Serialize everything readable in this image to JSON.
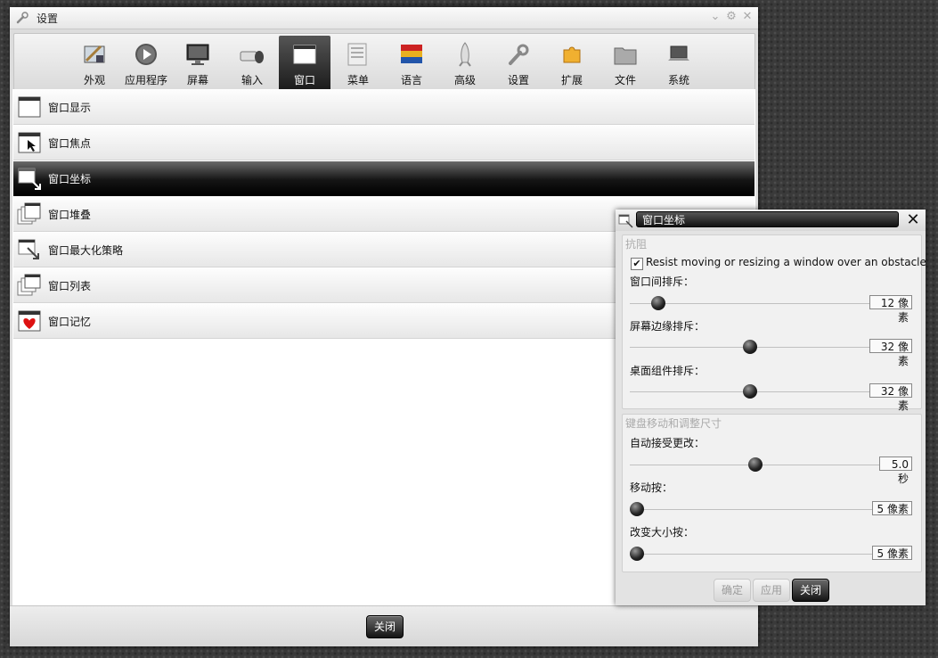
{
  "main_window": {
    "title": "设置",
    "toolbar": [
      {
        "label": "外观",
        "icon": "appearance-icon"
      },
      {
        "label": "应用程序",
        "icon": "applications-icon"
      },
      {
        "label": "屏幕",
        "icon": "screen-icon"
      },
      {
        "label": "输入",
        "icon": "input-icon"
      },
      {
        "label": "窗口",
        "icon": "window-icon",
        "active": true
      },
      {
        "label": "菜单",
        "icon": "menu-icon"
      },
      {
        "label": "语言",
        "icon": "language-icon"
      },
      {
        "label": "高级",
        "icon": "advanced-icon"
      },
      {
        "label": "设置",
        "icon": "settings-icon"
      },
      {
        "label": "扩展",
        "icon": "extensions-icon"
      },
      {
        "label": "文件",
        "icon": "files-icon"
      },
      {
        "label": "系统",
        "icon": "system-icon"
      }
    ],
    "list": [
      {
        "label": "窗口显示",
        "icon": "window-display-icon"
      },
      {
        "label": "窗口焦点",
        "icon": "window-focus-icon"
      },
      {
        "label": "窗口坐标",
        "icon": "window-geometry-icon",
        "selected": true
      },
      {
        "label": "窗口堆叠",
        "icon": "window-stacking-icon"
      },
      {
        "label": "窗口最大化策略",
        "icon": "window-maximize-icon"
      },
      {
        "label": "窗口列表",
        "icon": "window-list-icon"
      },
      {
        "label": "窗口记忆",
        "icon": "window-remember-icon"
      }
    ],
    "close_label": "关闭"
  },
  "dialog": {
    "title": "窗口坐标",
    "resist_group": {
      "title": "抗阻",
      "checkbox_label": "Resist moving or resizing a window over an obstacle",
      "checkbox_checked": true,
      "sliders": [
        {
          "label": "窗口间排斥：",
          "value_text": "12 像素",
          "fraction": 0.12
        },
        {
          "label": "屏幕边缘排斥：",
          "value_text": "32 像素",
          "fraction": 0.5
        },
        {
          "label": "桌面组件排斥：",
          "value_text": "32 像素",
          "fraction": 0.5
        }
      ]
    },
    "keyboard_group": {
      "title": "键盘移动和调整尺寸",
      "sliders": [
        {
          "label": "自动接受更改：",
          "value_text": "5.0 秒",
          "fraction": 0.5
        },
        {
          "label": "移动按：",
          "value_text": "5 像素",
          "fraction": 0.0
        },
        {
          "label": "改变大小按：",
          "value_text": "5 像素",
          "fraction": 0.0
        }
      ]
    },
    "buttons": {
      "ok": "确定",
      "apply": "应用",
      "close": "关闭"
    }
  }
}
